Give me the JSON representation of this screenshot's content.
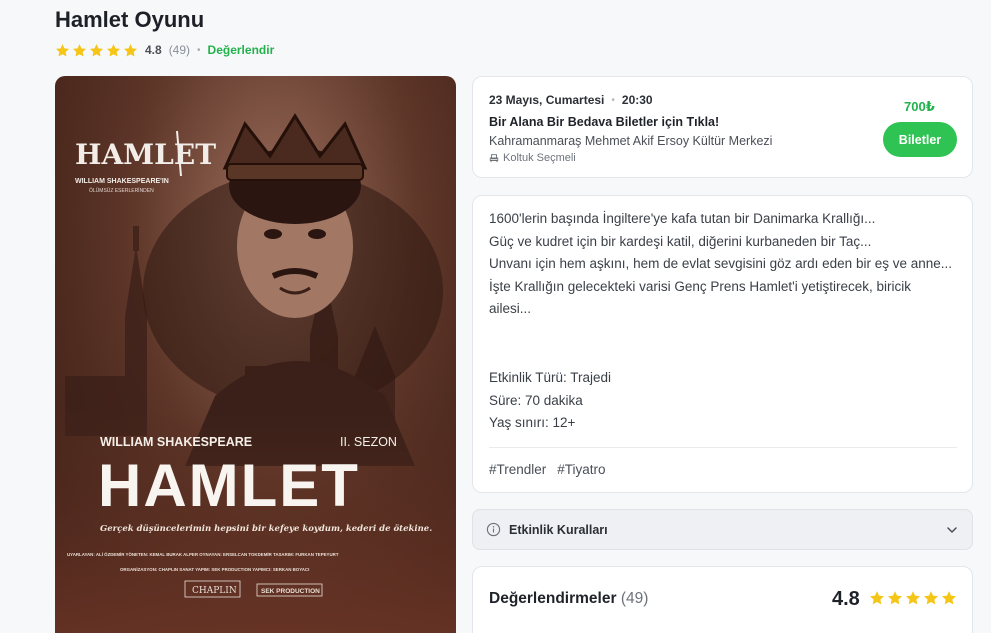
{
  "event": {
    "title": "Hamlet Oyunu",
    "rating": "4.8",
    "rating_count": "(49)",
    "rate_link": "Değerlendir",
    "stars": 5
  },
  "poster": {
    "logo_title": "HAMLET",
    "logo_sub1": "WILLIAM SHAKESPEARE'IN",
    "logo_sub2": "ÖLÜMSÜZ ESERLERİNDEN",
    "author": "WILLIAM SHAKESPEARE",
    "season": "II. SEZON",
    "big_title": "HAMLET",
    "quote": "Gerçek düşüncelerimin hepsini bir kefeye koydum, kederi de ötekine.",
    "credits1": "UYARLAYAN: ALİ ÖZDEMİR   YÖNETEN: KEMAL BURAK ALPER   OYNAYAN: ERSELCAN TOKDEMİR   TASARIM: FURKAN TEPEYURT",
    "credits2": "ORGANİZASYON: CHAPLIN SANAT   YAPIM: SEK PRODUCTION   YAPIMCI: SERKAN BOYACI",
    "logo_left": "CHAPLIN",
    "logo_right": "SEK PRODUCTION"
  },
  "showing": {
    "date": "23 Mayıs, Cumartesi",
    "time": "20:30",
    "promo": "Bir Alana Bir Bedava Biletler için Tıkla!",
    "venue": "Kahramanmaraş Mehmet Akif Ersoy Kültür Merkezi",
    "seat": "Koltuk Seçmeli",
    "price": "700₺",
    "button": "Biletler"
  },
  "description": {
    "lines": [
      "1600'lerin başında İngiltere'ye kafa tutan bir Danimarka Krallığı...",
      "Güç ve kudret için bir kardeşi katil, diğerini kurbaneden bir Taç...",
      "Unvanı için hem aşkını, hem de evlat sevgisini göz ardı eden bir eş ve anne...",
      "İşte Krallığın gelecekteki varisi Genç Prens Hamlet'i yetiştirecek, biricik ailesi..."
    ],
    "genre": "Etkinlik Türü: Trajedi",
    "duration": "Süre: 70 dakika",
    "age": "Yaş sınırı: 12+",
    "tags": [
      "#Trendler",
      "#Tiyatro"
    ]
  },
  "rules": {
    "label": "Etkinlik Kuralları"
  },
  "reviews": {
    "heading": "Değerlendirmeler",
    "count": "(49)",
    "score": "4.8",
    "stars": 5
  },
  "colors": {
    "accent_green": "#2ec353",
    "star_yellow": "#f5c518",
    "poster_brown": "#5c3426"
  }
}
